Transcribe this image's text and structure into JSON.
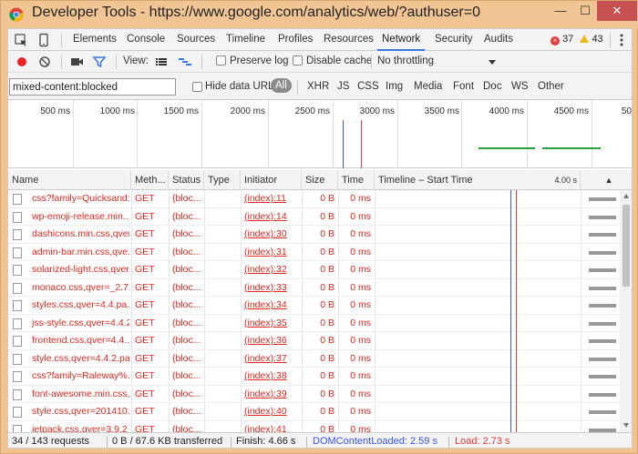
{
  "window": {
    "title": "Developer Tools - https://www.google.com/analytics/web/?authuser=0",
    "min_label": "—",
    "max_label": "☐",
    "close_label": "✕"
  },
  "tabs": [
    {
      "label": "Elements"
    },
    {
      "label": "Console"
    },
    {
      "label": "Sources"
    },
    {
      "label": "Timeline"
    },
    {
      "label": "Profiles"
    },
    {
      "label": "Resources"
    },
    {
      "label": "Network",
      "active": true
    },
    {
      "label": "Security"
    },
    {
      "label": "Audits"
    }
  ],
  "console_counts": {
    "errors": "37",
    "warnings": "43"
  },
  "toolbar": {
    "view_label": "View:",
    "preserve_log": "Preserve log",
    "disable_cache": "Disable cache",
    "throttling": "No throttling"
  },
  "filter": {
    "value": "mixed-content:blocked",
    "hide_data_urls": "Hide data URLs",
    "types": [
      "All",
      "XHR",
      "JS",
      "CSS",
      "Img",
      "Media",
      "Font",
      "Doc",
      "WS",
      "Other"
    ]
  },
  "overview_ticks": [
    "500 ms",
    "1000 ms",
    "1500 ms",
    "2000 ms",
    "2500 ms",
    "3000 ms",
    "3500 ms",
    "4000 ms",
    "4500 ms",
    "50"
  ],
  "columns": {
    "name": "Name",
    "method": "Meth...",
    "status": "Status",
    "type": "Type",
    "initiator": "Initiator",
    "size": "Size",
    "time": "Time",
    "timeline": "Timeline – Start Time",
    "timeline_end": "4.00 s",
    "sort": "▲"
  },
  "requests": [
    {
      "name": "css?family=Quicksand:...",
      "method": "GET",
      "status": "(bloc...",
      "initiator": "(index):11",
      "size": "0 B",
      "time": "0 ms"
    },
    {
      "name": "wp-emoji-release.min....",
      "method": "GET",
      "status": "(bloc...",
      "initiator": "(index):14",
      "size": "0 B",
      "time": "0 ms"
    },
    {
      "name": "dashicons.min.css,qver...",
      "method": "GET",
      "status": "(bloc...",
      "initiator": "(index):30",
      "size": "0 B",
      "time": "0 ms"
    },
    {
      "name": "admin-bar.min.css,qve...",
      "method": "GET",
      "status": "(bloc...",
      "initiator": "(index):31",
      "size": "0 B",
      "time": "0 ms"
    },
    {
      "name": "solarized-light.css,qver...",
      "method": "GET",
      "status": "(bloc...",
      "initiator": "(index):32",
      "size": "0 B",
      "time": "0 ms"
    },
    {
      "name": "monaco.css,qver=_2.7....",
      "method": "GET",
      "status": "(bloc...",
      "initiator": "(index):33",
      "size": "0 B",
      "time": "0 ms"
    },
    {
      "name": "styles.css,qver=4.4.pa...",
      "method": "GET",
      "status": "(bloc...",
      "initiator": "(index):34",
      "size": "0 B",
      "time": "0 ms"
    },
    {
      "name": "jss-style.css,qver=4.4.2...",
      "method": "GET",
      "status": "(bloc...",
      "initiator": "(index):35",
      "size": "0 B",
      "time": "0 ms"
    },
    {
      "name": "frontend.css,qver=4.4....",
      "method": "GET",
      "status": "(bloc...",
      "initiator": "(index):36",
      "size": "0 B",
      "time": "0 ms"
    },
    {
      "name": "style.css,qver=4.4.2.pa...",
      "method": "GET",
      "status": "(bloc...",
      "initiator": "(index):37",
      "size": "0 B",
      "time": "0 ms"
    },
    {
      "name": "css?family=Raleway%...",
      "method": "GET",
      "status": "(bloc...",
      "initiator": "(index):38",
      "size": "0 B",
      "time": "0 ms"
    },
    {
      "name": "font-awesome.min.css,...",
      "method": "GET",
      "status": "(bloc...",
      "initiator": "(index):39",
      "size": "0 B",
      "time": "0 ms"
    },
    {
      "name": "style.css,qver=201410...",
      "method": "GET",
      "status": "(bloc...",
      "initiator": "(index):40",
      "size": "0 B",
      "time": "0 ms"
    },
    {
      "name": "jetpack.css,qver=3.9.2",
      "method": "GET",
      "status": "(bloc...",
      "initiator": "(index):41",
      "size": "0 B",
      "time": "0 ms"
    }
  ],
  "status": {
    "requests": "34 / 143 requests",
    "transferred": "0 B / 67.6 KB transferred",
    "finish": "Finish: 4.66 s",
    "dom_loaded": "DOMContentLoaded: 2.59 s",
    "load": "Load: 2.73 s"
  },
  "colors": {
    "accent": "#3879d9",
    "error": "#e0281f",
    "dom_line": "#3b56f0",
    "load_line": "#e23b3b",
    "overview_bar": "#23a23e"
  }
}
